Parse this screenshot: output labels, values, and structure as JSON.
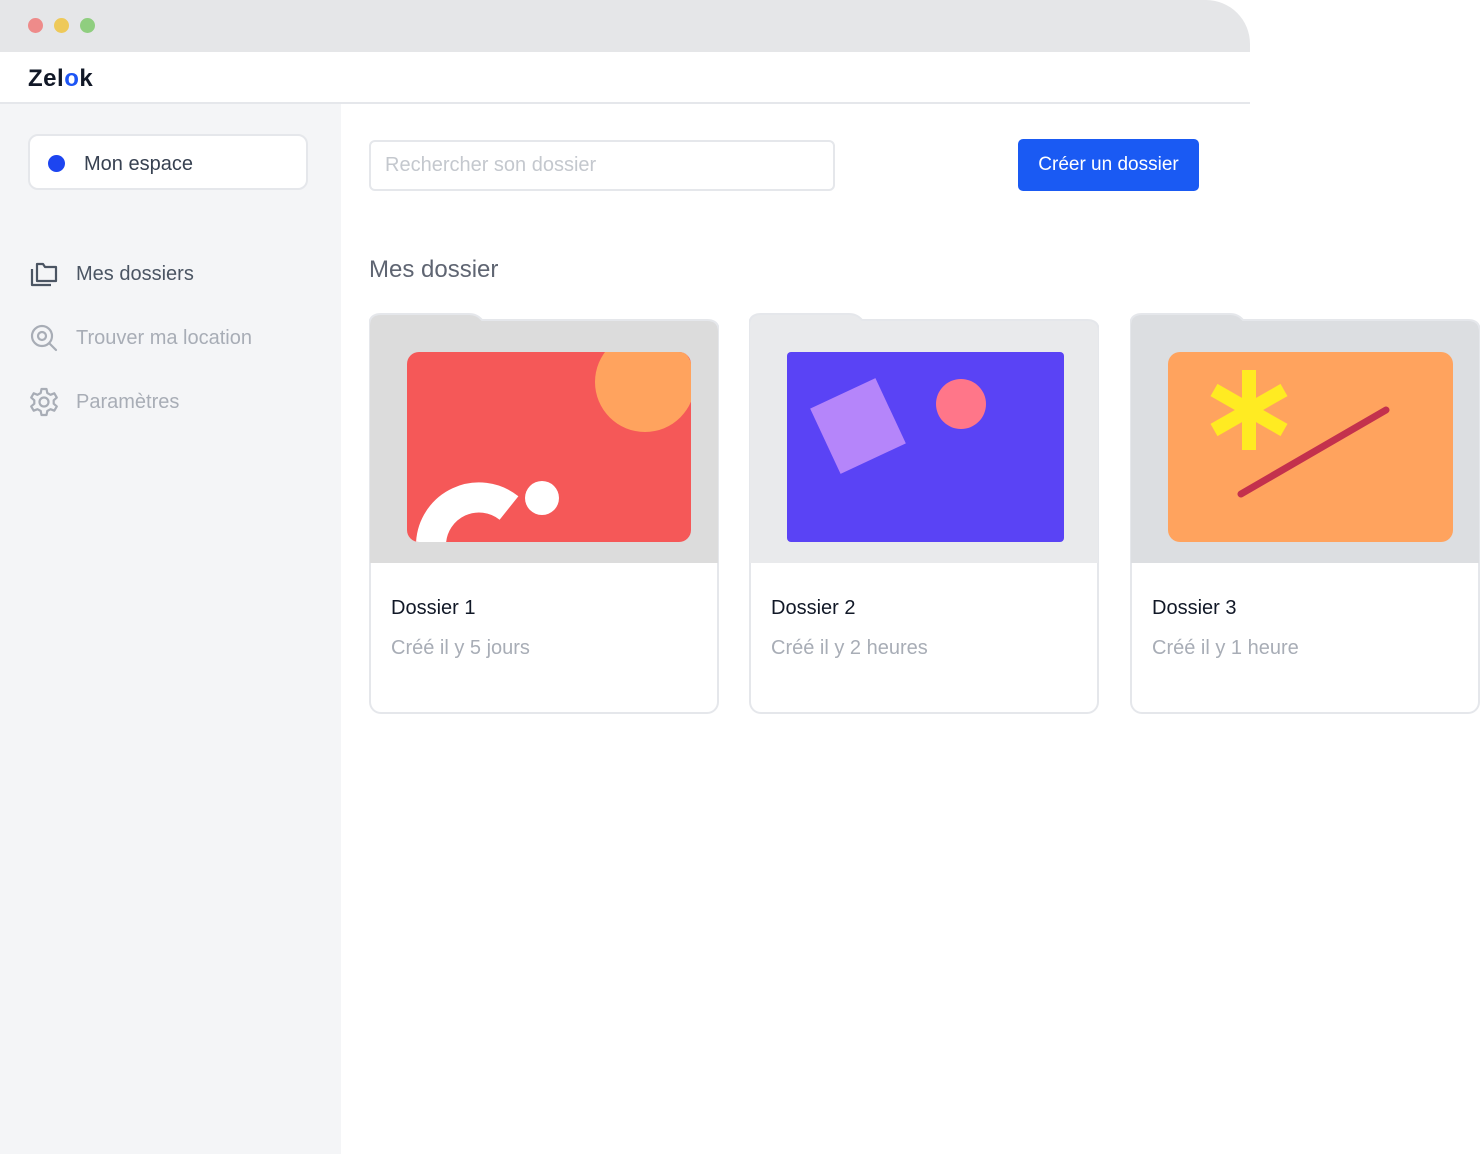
{
  "window": {
    "controls": [
      "close-dot",
      "minimize-dot",
      "maximize-dot"
    ]
  },
  "app": {
    "logo_pre": "Zel",
    "logo_accent": "o",
    "logo_post": "k",
    "accent_color": "#1d55f5"
  },
  "sidebar": {
    "workspace_label": "Mon espace",
    "items": [
      {
        "label": "Mes dossiers",
        "icon": "folders-icon",
        "active": true
      },
      {
        "label": "Trouver ma location",
        "icon": "search-location-icon",
        "active": false
      },
      {
        "label": "Paramètres",
        "icon": "gear-icon",
        "active": false
      }
    ]
  },
  "toolbar": {
    "search_placeholder": "Rechercher son dossier",
    "create_label": "Créer un dossier",
    "button_color": "#1a5af3"
  },
  "main": {
    "section_title": "Mes dossier",
    "folders": [
      {
        "title": "Dossier 1",
        "subtitle": "Créé il y 5 jours",
        "folder_color": "#dcdcdc",
        "art_color": "#f55858"
      },
      {
        "title": "Dossier 2",
        "subtitle": "Créé il y 2 heures",
        "folder_color": "#e9eaec",
        "art_color": "#5a43f5"
      },
      {
        "title": "Dossier 3",
        "subtitle": "Créé il y 1 heure",
        "folder_color": "#dcdee1",
        "art_color": "#ffa35e"
      }
    ]
  }
}
